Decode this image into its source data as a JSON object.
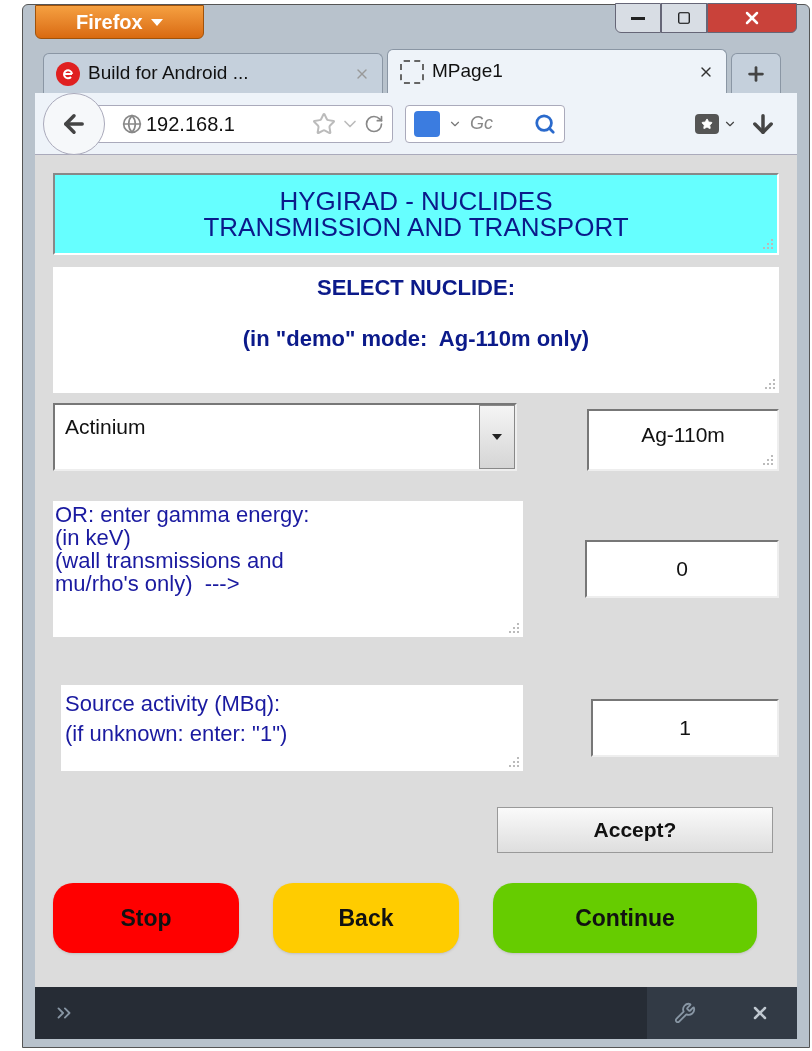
{
  "app_menu": {
    "label": "Firefox"
  },
  "tabs": [
    {
      "label": "Build for Android ...",
      "selected": false,
      "kind": "site"
    },
    {
      "label": "MPage1",
      "selected": true,
      "kind": "blank"
    }
  ],
  "address_bar": {
    "value": "192.168.1"
  },
  "search_bar": {
    "placeholder": "Gc"
  },
  "header": {
    "lines": [
      "HYGIRAD - NUCLIDES",
      "TRANSMISSION AND TRANSPORT"
    ]
  },
  "instructions": {
    "lines": [
      "SELECT NUCLIDE:",
      "(in \"demo\" mode:  Ag-110m only)"
    ]
  },
  "nuclide_select": {
    "value": "Actinium"
  },
  "nuclide_field": {
    "value": "Ag-110m"
  },
  "energy": {
    "label_lines": [
      "OR: enter gamma energy:",
      "(in keV)",
      "(wall transmissions and",
      "mu/rho's only)  --->"
    ],
    "value": "0"
  },
  "activity": {
    "label_lines": [
      "Source activity (MBq):",
      "(if unknown: enter: \"1\")"
    ],
    "value": "1"
  },
  "accept_button": "Accept?",
  "nav_buttons": [
    {
      "label": "Stop",
      "color": "#ff0000"
    },
    {
      "label": "Back",
      "color": "#ffcc00"
    },
    {
      "label": "Continue",
      "color": "#66cc00"
    }
  ]
}
